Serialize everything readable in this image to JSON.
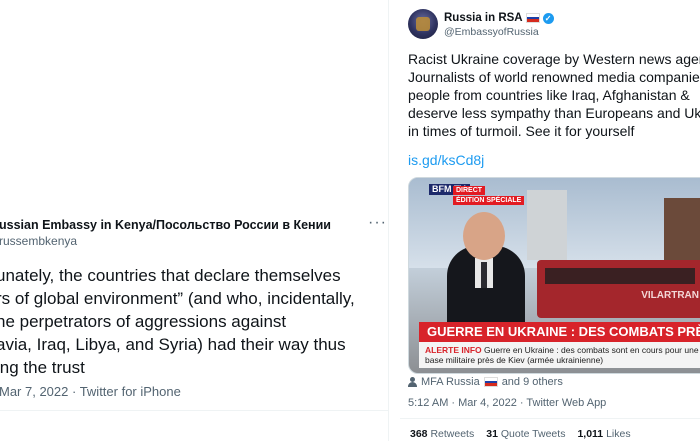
{
  "left_tweet": {
    "author_name": "ussian Embassy in Kenya/Посольство России в Кении",
    "handle": "russembkenya",
    "more_label": "···",
    "body": "unately, the countries that declare themselves\nrs of global environment” (and who, incidentally,\nhe perpetrators of aggressions against\navia, Iraq, Libya, and Syria) had their way thus\ning the trust",
    "meta": "Mar 7, 2022 · Twitter for iPhone"
  },
  "right_tweet": {
    "author_name": "Russia in RSA",
    "handle": "@EmbassyofRussia",
    "body": "Racist Ukraine coverage by Western news agen\nJournalists of world renowned media companie\npeople from countries like Iraq, Afghanistan & \ndeserve less sympathy than Europeans and Uk\nin times of turmoil. See it for yourself",
    "link": "is.gd/ksCd8j",
    "media": {
      "channel": "BFM TV.",
      "live_badge": "DIRECT",
      "edition_badge": "ÉDITION SPÉCIALE",
      "bus_text": "VILARTRAN",
      "headline": "GUERRE EN UKRAINE : DES COMBATS PRÈS DE KIEV",
      "ticker_label": "ALERTE INFO",
      "ticker_text": "Guerre en Ukraine : des combats sont en cours pour une base militaire près de Kiev",
      "ticker_source": "(armée ukrainienne)"
    },
    "tagged": "MFA Russia",
    "tagged_suffix": "and 9 others",
    "meta": "5:12 AM · Mar 4, 2022 · Twitter Web App",
    "stats": {
      "retweets_count": "368",
      "retweets_label": "Retweets",
      "quotes_count": "31",
      "quotes_label": "Quote Tweets",
      "likes_count": "1,011",
      "likes_label": "Likes"
    },
    "colors": {
      "verified": "#1d9bf0",
      "link": "#1d9bf0",
      "headline_bg": "#d8232a"
    }
  }
}
